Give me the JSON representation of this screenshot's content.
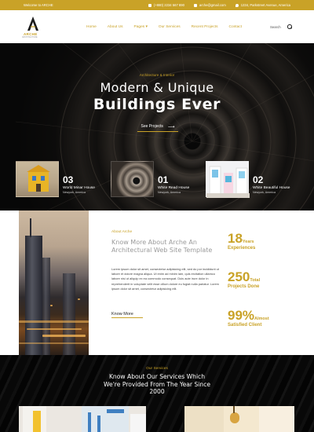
{
  "topbar": {
    "welcome": "Welcome to ARCHE",
    "phone": "(+880) 2234 567 890",
    "email": "arche@gmail.com",
    "address": "1234, Parkstreet Avenue, America"
  },
  "logo": {
    "name": "ARCHE",
    "tagline": "ARCHITECTURE"
  },
  "nav": {
    "items": [
      "Home",
      "About Us",
      "Pages",
      "Our Services",
      "Recent Projects",
      "Contact"
    ],
    "search_label": "Search"
  },
  "hero": {
    "subtitle": "Architecture & Interior",
    "title_line1": "Modern & Unique",
    "title_line2": "Buildings Ever",
    "button": "See Projects"
  },
  "properties": [
    {
      "num": "03",
      "name": "World Minar House",
      "location": "Newyork, America"
    },
    {
      "num": "01",
      "name": "White Read House",
      "location": "Newyork, America"
    },
    {
      "num": "02",
      "name": "White Beautiful House",
      "location": "Newyork, America"
    }
  ],
  "about": {
    "tag": "About Arche",
    "title": "Know More About Arche An Architectural Web Site Template",
    "body": "Lorem ipsum dolor sit amet, consectetur adipisicing elit, sed do por incididunt ut labore et dolore magna aliqua. Ut enim ad minim iam, quis ercitation ullamco labore nisi ut aliquip ex ea commodo consequat. Duis aute irure dolor in reprehenderit in voluptate velit esse cillum dolore eu fugiat nulla pariatur. Lorem ipsum dolor sit amet, consectetur adipisicing elit.",
    "button": "Know More"
  },
  "stats": [
    {
      "value": "18",
      "suffix": "Years",
      "caption": "Experiences"
    },
    {
      "value": "250",
      "suffix": "Total",
      "caption": "Projects Done"
    },
    {
      "value": "99%",
      "suffix": "Almost",
      "caption": "Satisfied Client"
    }
  ],
  "services": {
    "tag": "Our Services",
    "title": "Know About Our Services Which We're Provided From The Year Since 2000"
  },
  "colors": {
    "accent": "#c9a227",
    "dark": "#111111"
  }
}
